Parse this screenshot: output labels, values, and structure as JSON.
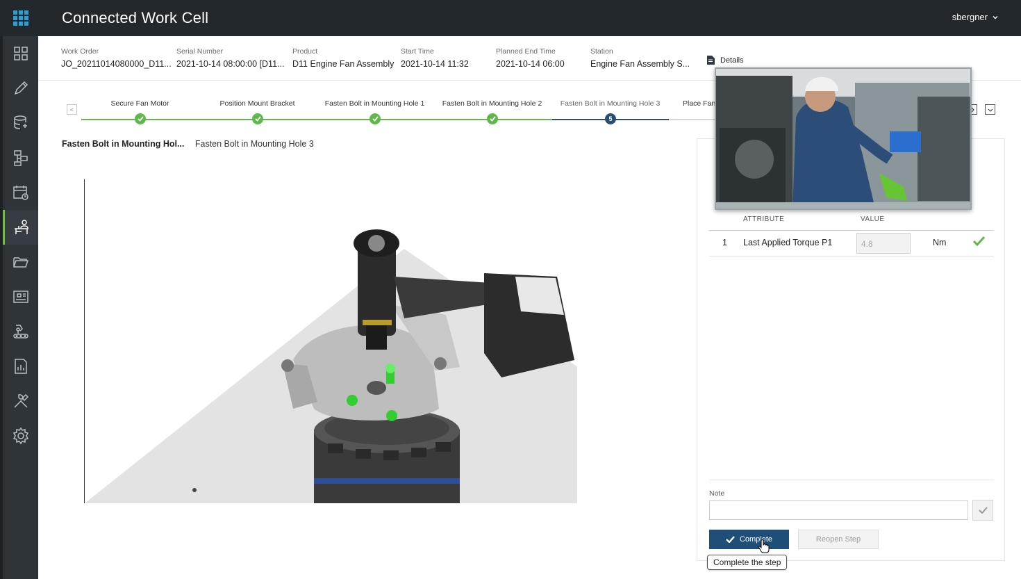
{
  "app": {
    "title": "Connected Work Cell",
    "user": "sbergner",
    "accent_color": "#6cbf3e",
    "primary_color": "#1f4e79"
  },
  "sidebar": {
    "items": [
      {
        "icon": "dashboard-icon"
      },
      {
        "icon": "edit-icon"
      },
      {
        "icon": "database-icon"
      },
      {
        "icon": "workflow-icon"
      },
      {
        "icon": "schedule-icon"
      },
      {
        "icon": "operator-station-icon",
        "active": true
      },
      {
        "icon": "folder-icon"
      },
      {
        "icon": "equipment-icon"
      },
      {
        "icon": "conveyor-robot-icon"
      },
      {
        "icon": "report-icon"
      },
      {
        "icon": "tools-icon"
      },
      {
        "icon": "settings-icon"
      }
    ]
  },
  "header": {
    "work_order_label": "Work Order",
    "work_order": "JO_20211014080000_D11...",
    "serial_label": "Serial Number",
    "serial": "2021-10-14 08:00:00 [D11...",
    "product_label": "Product",
    "product": "D11 Engine Fan Assembly",
    "start_label": "Start Time",
    "start": "2021-10-14 11:32",
    "planned_end_label": "Planned End Time",
    "planned_end": "2021-10-14 06:00",
    "station_label": "Station",
    "station": "Engine Fan Assembly S...",
    "details_label": "Details"
  },
  "steps": {
    "prev_label": "<",
    "items": [
      {
        "label": "Secure Fan Motor",
        "status": "done"
      },
      {
        "label": "Position Mount Bracket",
        "status": "done"
      },
      {
        "label": "Fasten Bolt in Mounting Hole 1",
        "status": "done"
      },
      {
        "label": "Fasten Bolt in Mounting Hole 2",
        "status": "done"
      },
      {
        "label": "Fasten Bolt in Mounting Hole 3",
        "status": "current",
        "number": "5"
      },
      {
        "label": "Place Fan",
        "status": "pending"
      }
    ]
  },
  "breadcrumb": {
    "group": "Fasten Bolt in Mounting Hol...",
    "step": "Fasten Bolt in Mounting Hole 3"
  },
  "panel": {
    "attribute_header": "ATTRIBUTE",
    "value_header": "VALUE",
    "rows": [
      {
        "num": "1",
        "attribute": "Last Applied Torque P1",
        "value": "4.8",
        "unit": "Nm"
      }
    ],
    "note_label": "Note",
    "note_value": "",
    "complete_label": "Complete",
    "reopen_label": "Reopen Step",
    "tooltip": "Complete the step"
  }
}
